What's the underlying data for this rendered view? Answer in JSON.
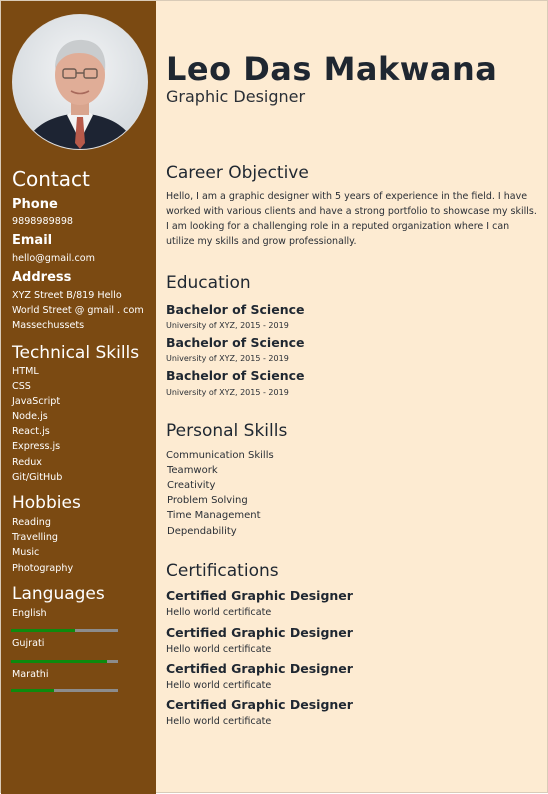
{
  "profile": {
    "name": "Leo Das Makwana",
    "role": "Graphic Designer"
  },
  "contact": {
    "heading": "Contact",
    "phone_label": "Phone",
    "phone": "9898989898",
    "email_label": "Email",
    "email": "hello@gmail.com",
    "address_label": "Address",
    "address_lines": [
      "XYZ Street B/819 Hello",
      "World Street @ gmail . com",
      "Massechussets"
    ]
  },
  "technical_skills": {
    "heading": "Technical Skills",
    "items": [
      "HTML",
      "CSS",
      "JavaScript",
      "Node.js",
      "React.js",
      "Express.js",
      "Redux",
      "Git/GitHub"
    ]
  },
  "hobbies": {
    "heading": "Hobbies",
    "items": [
      "Reading",
      "Travelling",
      "Music",
      "Photography"
    ]
  },
  "languages": {
    "heading": "Languages",
    "items": [
      {
        "name": "English",
        "level": 0.6
      },
      {
        "name": "Gujrati",
        "level": 0.9
      },
      {
        "name": "Marathi",
        "level": 0.4
      }
    ],
    "bar_color": "#0e8a0e",
    "track_color": "#8c8c8c"
  },
  "career": {
    "heading": "Career Objective",
    "text": "Hello, I am a graphic designer with 5 years of experience in the field. I have worked with various clients and have a strong portfolio to showcase my skills. I am looking for a challenging role in a reputed organization where I can utilize my skills and grow professionally."
  },
  "education": {
    "heading": "Education",
    "items": [
      {
        "degree": "Bachelor of Science",
        "detail": "University of XYZ, 2015 - 2019"
      },
      {
        "degree": "Bachelor of Science",
        "detail": "University of XYZ, 2015 - 2019"
      },
      {
        "degree": "Bachelor of Science",
        "detail": "University of XYZ, 2015 - 2019"
      }
    ]
  },
  "personal_skills": {
    "heading": "Personal Skills",
    "items": [
      "Communication Skills",
      "Teamwork",
      "Creativity",
      "Problem Solving",
      "Time Management",
      "Dependability"
    ]
  },
  "certifications": {
    "heading": "Certifications",
    "items": [
      {
        "title": "Certified Graphic Designer",
        "detail": "Hello world certificate"
      },
      {
        "title": "Certified Graphic Designer",
        "detail": "Hello world certificate"
      },
      {
        "title": "Certified Graphic Designer",
        "detail": "Hello world certificate"
      },
      {
        "title": "Certified Graphic Designer",
        "detail": "Hello world certificate"
      }
    ]
  },
  "colors": {
    "sidebar": "#7b4a12",
    "page_background": "#fdebd2"
  }
}
